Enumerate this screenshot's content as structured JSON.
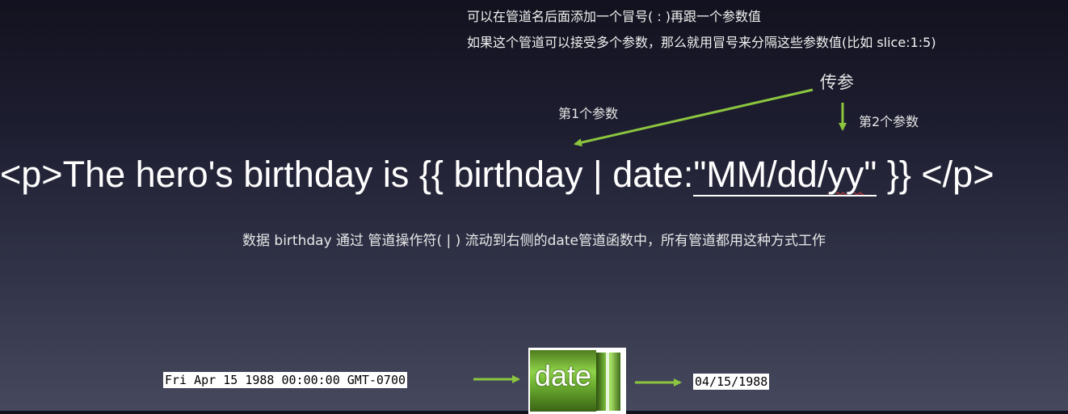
{
  "notes": {
    "line1": "可以在管道名后面添加一个冒号( : )再跟一个参数值",
    "line2": "如果这个管道可以接受多个参数，那么就用冒号来分隔这些参数值(比如 slice:1:5)"
  },
  "labels": {
    "pass_params": "传参",
    "param1": "第1个参数",
    "param2": "第2个参数"
  },
  "code": {
    "prefix": "<p>The hero's birthday is {{ birthday | date:",
    "arg_open": "\"MM/dd/",
    "arg_wavy": "yy",
    "arg_close": "\"",
    "suffix": " }} </p>"
  },
  "caption": "数据 birthday 通过 管道操作符( | ) 流动到右侧的date管道函数中，所有管道都用这种方式工作",
  "flow": {
    "input": "Fri Apr 15 1988 00:00:00 GMT-0700",
    "pipe": "date",
    "output": "04/15/1988"
  },
  "colors": {
    "arrow": "#8cc63f",
    "pipe": "#7cc13e",
    "squiggle": "#e03c3c"
  }
}
